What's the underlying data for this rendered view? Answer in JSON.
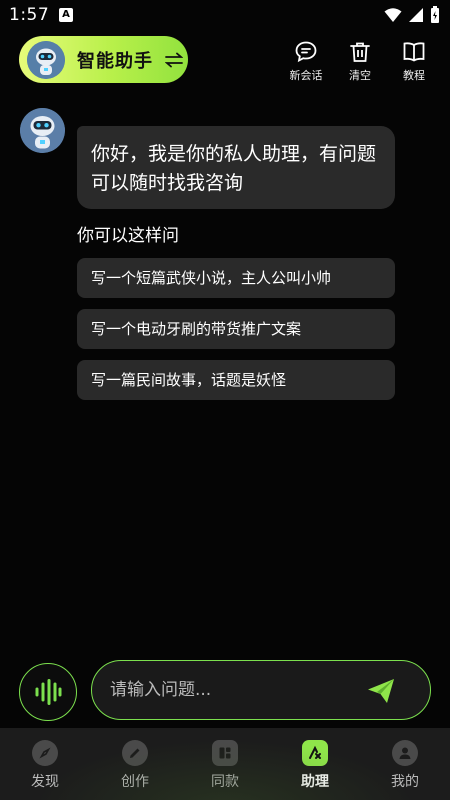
{
  "status_bar": {
    "time": "1:57",
    "notif_letter": "A"
  },
  "header": {
    "assistant_name": "智能助手",
    "actions": [
      {
        "label": "新会话",
        "icon": "new-chat-icon"
      },
      {
        "label": "清空",
        "icon": "trash-icon"
      },
      {
        "label": "教程",
        "icon": "book-icon"
      }
    ]
  },
  "chat": {
    "greeting_line1": "你好，我是你的私人助理，有问题",
    "greeting_line2": "可以随时找我咨询",
    "suggest_heading": "你可以这样问",
    "suggestions": [
      "写一个短篇武侠小说，主人公叫小帅",
      "写一个电动牙刷的带货推广文案",
      "写一篇民间故事，话题是妖怪"
    ]
  },
  "input": {
    "placeholder": "请输入问题..."
  },
  "nav": {
    "items": [
      {
        "label": "发现",
        "icon": "compass-icon"
      },
      {
        "label": "创作",
        "icon": "pencil-icon"
      },
      {
        "label": "同款",
        "icon": "grid-icon"
      },
      {
        "label": "助理",
        "icon": "assistant-icon",
        "active": true
      },
      {
        "label": "我的",
        "icon": "user-icon"
      }
    ]
  },
  "colors": {
    "accent": "#8fe54a",
    "background": "#050505",
    "bubble": "#2a2a2a"
  }
}
